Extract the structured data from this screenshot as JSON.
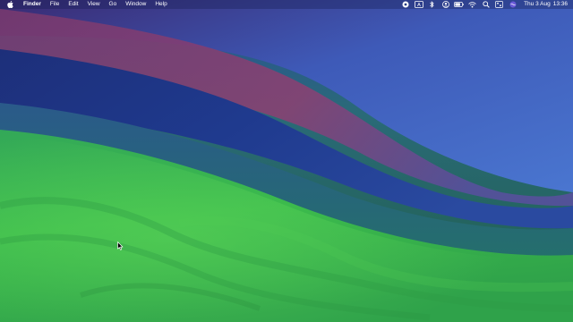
{
  "menubar": {
    "apple_icon": "apple-logo-icon",
    "app_name": "Finder",
    "menus": [
      "File",
      "Edit",
      "View",
      "Go",
      "Window",
      "Help"
    ],
    "status_icons": [
      "screen-recording-icon",
      "input-source-icon",
      "bluetooth-icon",
      "user-account-icon",
      "battery-icon",
      "wifi-icon",
      "spotlight-search-icon",
      "control-center-icon",
      "siri-icon"
    ],
    "input_source_label": "A",
    "clock": {
      "date": "Thu 3 Aug",
      "time": "13:36"
    }
  },
  "desktop": {
    "wallpaper": "macOS Sonoma",
    "colors": {
      "green": "#3fbf4c",
      "navy": "#1f3a86",
      "magenta": "#8e3a6e",
      "blue": "#3f62c4",
      "teal": "#256f6c"
    }
  }
}
